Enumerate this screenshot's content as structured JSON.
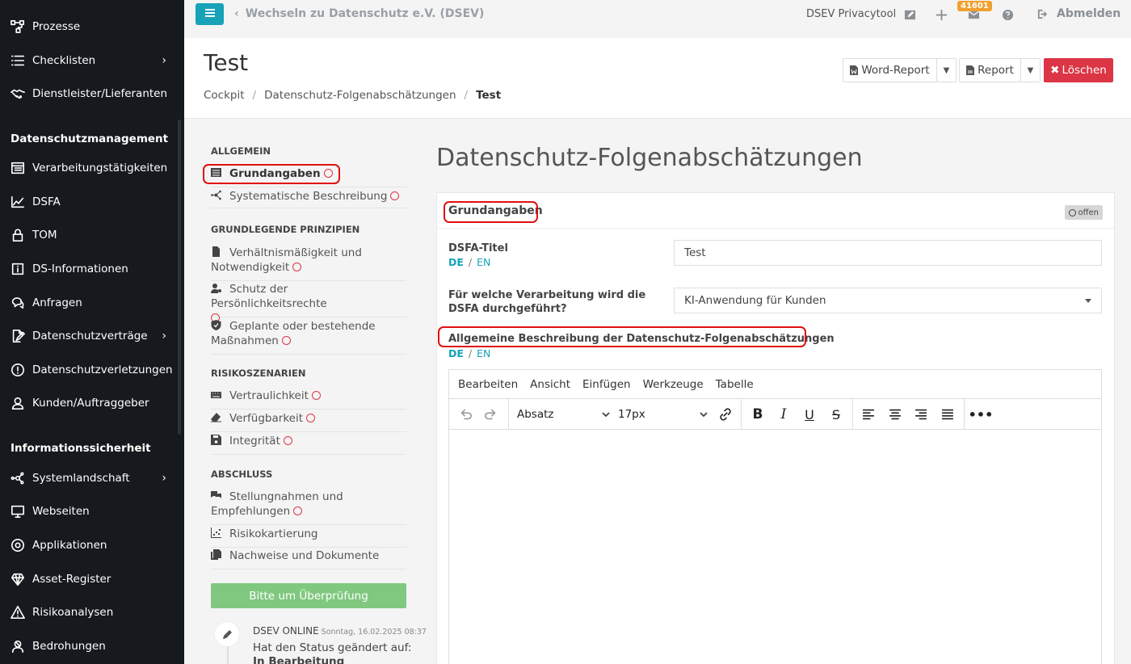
{
  "sidebar": {
    "top_items": [
      {
        "label": "Prozesse",
        "icon": "process-icon"
      },
      {
        "label": "Checklisten",
        "icon": "list-icon",
        "has_submenu": true
      },
      {
        "label": "Dienstleister/Lieferanten",
        "icon": "handshake-icon"
      }
    ],
    "section1_title": "Datenschutzmanagement",
    "section1_items": [
      {
        "label": "Verarbeitungstätigkeiten",
        "icon": "table-icon"
      },
      {
        "label": "DSFA",
        "icon": "chart-icon"
      },
      {
        "label": "TOM",
        "icon": "lock-icon"
      },
      {
        "label": "DS-Informationen",
        "icon": "info-icon"
      },
      {
        "label": "Anfragen",
        "icon": "chat-icon"
      },
      {
        "label": "Datenschutzverträge",
        "icon": "contract-icon",
        "has_submenu": true
      },
      {
        "label": "Datenschutzverletzungen",
        "icon": "alert-icon"
      },
      {
        "label": "Kunden/Auftraggeber",
        "icon": "user-icon"
      }
    ],
    "section2_title": "Informationssicherheit",
    "section2_items": [
      {
        "label": "Systemlandschaft",
        "icon": "network-icon",
        "has_submenu": true
      },
      {
        "label": "Webseiten",
        "icon": "monitor-icon"
      },
      {
        "label": "Applikationen",
        "icon": "app-icon"
      },
      {
        "label": "Asset-Register",
        "icon": "diamond-icon"
      },
      {
        "label": "Risikoanalysen",
        "icon": "warning-icon"
      },
      {
        "label": "Bedrohungen",
        "icon": "threat-icon"
      }
    ]
  },
  "topbar": {
    "switch_label": "Wechseln zu Datenschutz e.V. (DSEV)",
    "tool_title": "DSEV Privacytool",
    "badge_count": "41601",
    "logout_label": "Abmelden"
  },
  "header": {
    "title": "Test",
    "breadcrumb": [
      "Cockpit",
      "Datenschutz-Folgenabschätzungen",
      "Test"
    ],
    "word_report_label": "Word-Report",
    "report_label": "Report",
    "delete_label": "Löschen"
  },
  "subnav": {
    "sections": [
      {
        "title": "ALLGEMEIN",
        "items": [
          "Grundangaben",
          "Systematische Beschreibung"
        ]
      },
      {
        "title": "GRUNDLEGENDE PRINZIPIEN",
        "items": [
          "Verhältnismäßigkeit und Notwendigkeit",
          "Schutz der Persönlichkeitsrechte",
          "Geplante oder bestehende Maßnahmen"
        ]
      },
      {
        "title": "RISIKOSZENARIEN",
        "items": [
          "Vertraulichkeit",
          "Verfügbarkeit",
          "Integrität"
        ]
      },
      {
        "title": "ABSCHLUSS",
        "items": [
          "Stellungnahmen und Empfehlungen",
          "Risikokartierung",
          "Nachweise und Dokumente"
        ]
      }
    ],
    "review_button": "Bitte um Überprüfung",
    "timeline": {
      "author": "DSEV ONLINE",
      "date": "Sonntag, 16.02.2025 08:37",
      "text": "Hat den Status geändert auf:",
      "status": "In Bearbeitung"
    }
  },
  "main": {
    "title": "Datenschutz-Folgenabschätzungen",
    "card_title": "Grundangaben",
    "status": "offen",
    "field1_label": "DSFA-Titel",
    "field1_value": "Test",
    "lang_de": "DE",
    "lang_en": "EN",
    "field2_label": "Für welche Verarbeitung wird die DSFA durchgeführt?",
    "field2_value": "KI-Anwendung für Kunden",
    "field3_label": "Allgemeine Beschreibung der Datenschutz-Folgenabschätzungen",
    "editor": {
      "menu": [
        "Bearbeiten",
        "Ansicht",
        "Einfügen",
        "Werkzeuge",
        "Tabelle"
      ],
      "block_format": "Absatz",
      "font_size": "17px"
    }
  }
}
